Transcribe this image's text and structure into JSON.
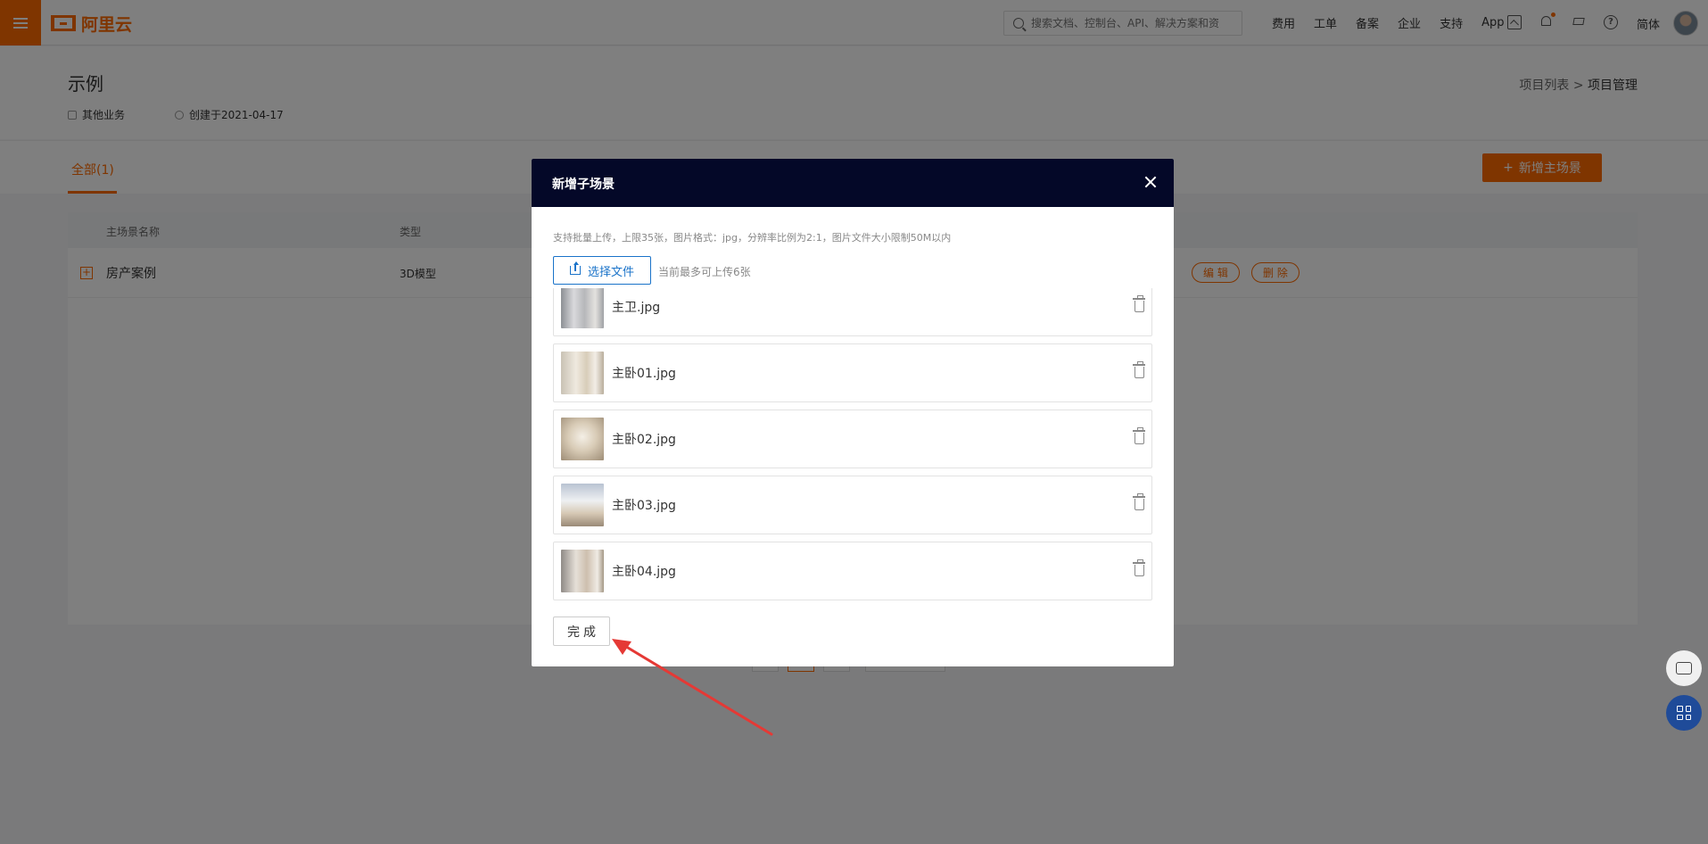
{
  "topbar": {
    "brand": "阿里云",
    "search_placeholder": "搜索文档、控制台、API、解决方案和资",
    "nav": [
      "费用",
      "工单",
      "备案",
      "企业",
      "支持",
      "App"
    ],
    "lang": "简体",
    "icons": [
      "menu-icon",
      "search-icon",
      "image-icon",
      "bell-icon",
      "cart-icon",
      "help-icon"
    ],
    "accent": "#ff6a00"
  },
  "page": {
    "title": "示例",
    "category": "其他业务",
    "created": "创建于2021-04-17",
    "breadcrumb": {
      "list": "项目列表",
      "sep": ">",
      "current": "项目管理"
    }
  },
  "tabs": {
    "active": "全部(1)"
  },
  "add_main_button": "新增主场景",
  "table": {
    "headers": {
      "name": "主场景名称",
      "type": "类型"
    },
    "row": {
      "name": "房产案例",
      "type": "3D模型",
      "edit": "编 辑",
      "delete": "删 除"
    }
  },
  "modal": {
    "title": "新增子场景",
    "hint": "支持批量上传，上限35张，图片格式：jpg，分辨率比例为2:1，图片文件大小限制50M以内",
    "choose_button": "选择文件",
    "limit_note": "当前最多可上传6张",
    "files": [
      {
        "name": "主卫.jpg"
      },
      {
        "name": "主卧01.jpg"
      },
      {
        "name": "主卧02.jpg"
      },
      {
        "name": "主卧03.jpg"
      },
      {
        "name": "主卧04.jpg"
      }
    ],
    "done_button": "完成",
    "header_color": "#040828",
    "button_color": "#1a73c9"
  },
  "annotation": {
    "arrow_color": "#e53935"
  }
}
